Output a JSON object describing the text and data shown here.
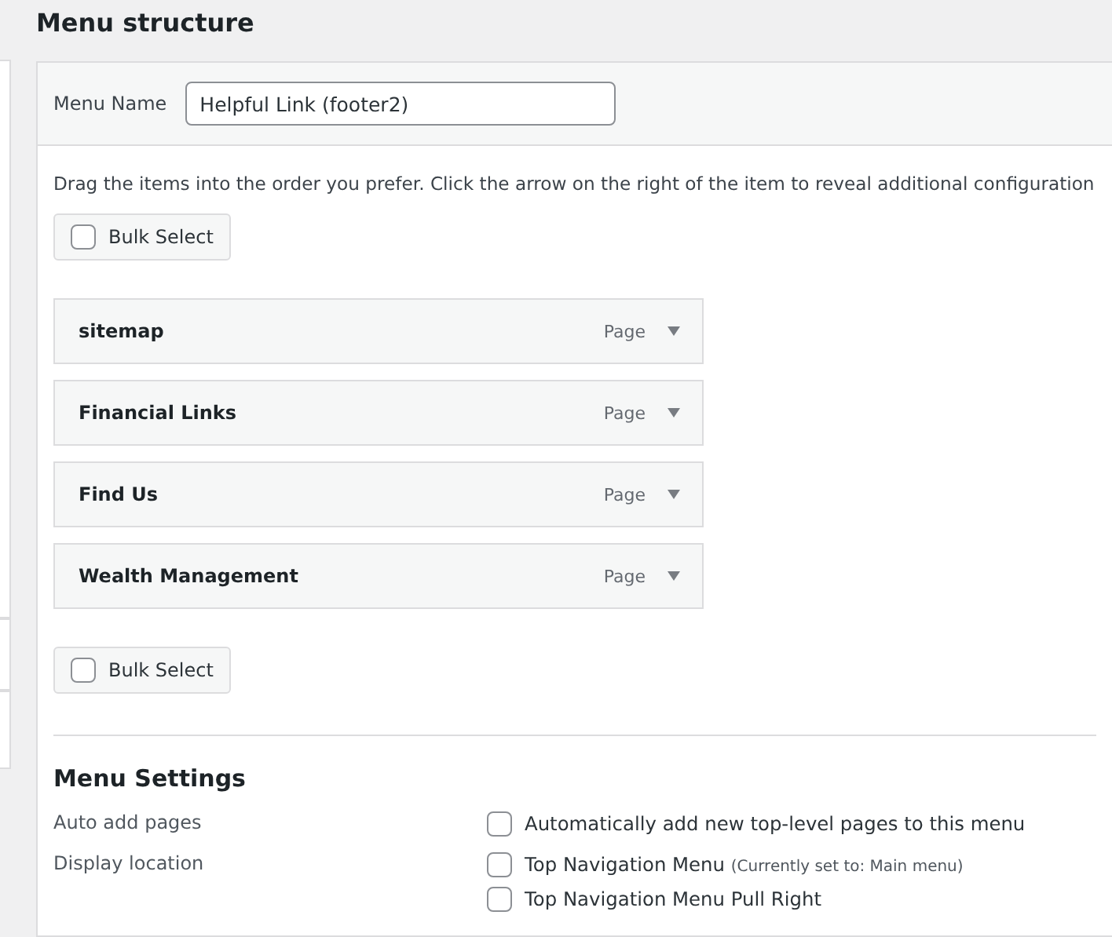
{
  "heading": "Menu structure",
  "menu_name": {
    "label": "Menu Name",
    "value": "Helpful Link (footer2)"
  },
  "instructions": "Drag the items into the order you prefer. Click the arrow on the right of the item to reveal additional configuration",
  "bulk_select_top": {
    "label": "Bulk Select",
    "checked": false
  },
  "menu_items": [
    {
      "title": "sitemap",
      "type": "Page"
    },
    {
      "title": "Financial Links",
      "type": "Page"
    },
    {
      "title": "Find Us",
      "type": "Page"
    },
    {
      "title": "Wealth Management",
      "type": "Page"
    }
  ],
  "bulk_select_bottom": {
    "label": "Bulk Select",
    "checked": false
  },
  "settings": {
    "title": "Menu Settings",
    "rows": [
      {
        "label": "Auto add pages",
        "options": [
          {
            "label": "Automatically add new top-level pages to this menu",
            "checked": false
          }
        ]
      },
      {
        "label": "Display location",
        "options": [
          {
            "label": "Top Navigation Menu",
            "note": "(Currently set to: Main menu)",
            "checked": false
          },
          {
            "label": "Top Navigation Menu Pull Right",
            "checked": false
          }
        ]
      }
    ]
  }
}
